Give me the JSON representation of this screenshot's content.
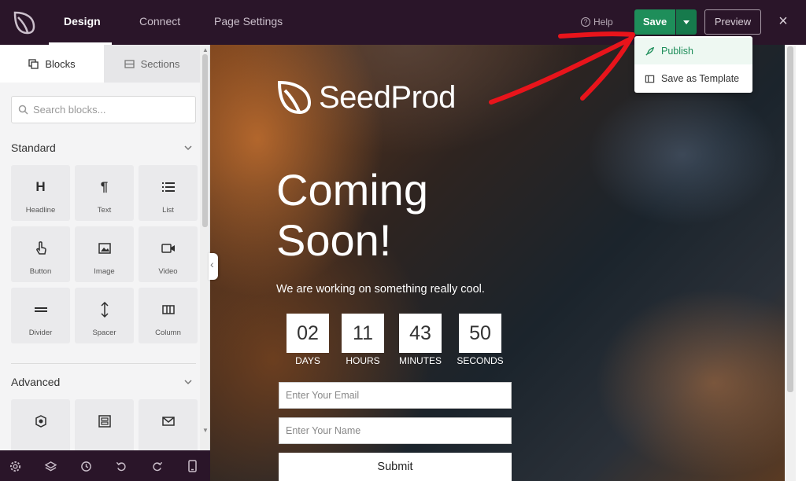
{
  "topbar": {
    "tabs": [
      "Design",
      "Connect",
      "Page Settings"
    ],
    "help_label": "Help",
    "save_label": "Save",
    "preview_label": "Preview",
    "close_symbol": "×"
  },
  "save_menu": {
    "items": [
      {
        "label": "Publish",
        "icon": "rocket-icon"
      },
      {
        "label": "Save as Template",
        "icon": "template-icon"
      }
    ]
  },
  "left_panel": {
    "tabs": [
      "Blocks",
      "Sections"
    ],
    "search_placeholder": "Search blocks...",
    "groups": [
      {
        "title": "Standard",
        "blocks": [
          {
            "label": "Headline",
            "icon": "H"
          },
          {
            "label": "Text",
            "icon": "¶"
          },
          {
            "label": "List",
            "icon": "list-icon"
          },
          {
            "label": "Button",
            "icon": "pointer-icon"
          },
          {
            "label": "Image",
            "icon": "image-icon"
          },
          {
            "label": "Video",
            "icon": "video-icon"
          },
          {
            "label": "Divider",
            "icon": "divider-icon"
          },
          {
            "label": "Spacer",
            "icon": "spacer-icon"
          },
          {
            "label": "Column",
            "icon": "column-icon"
          }
        ]
      },
      {
        "title": "Advanced",
        "blocks": [
          {
            "label": "",
            "icon": "badge-icon"
          },
          {
            "label": "",
            "icon": "form-icon"
          },
          {
            "label": "",
            "icon": "mail-icon"
          }
        ]
      }
    ]
  },
  "bottom_toolbar": [
    "settings-icon",
    "layers-icon",
    "history-icon",
    "undo-icon",
    "redo-icon",
    "mobile-icon"
  ],
  "page": {
    "brand": "SeedProd",
    "headline_line1": "Coming",
    "headline_line2": "Soon!",
    "subtext": "We are working on something really cool.",
    "countdown": [
      {
        "value": "02",
        "label": "DAYS"
      },
      {
        "value": "11",
        "label": "HOURS"
      },
      {
        "value": "43",
        "label": "MINUTES"
      },
      {
        "value": "50",
        "label": "SECONDS"
      }
    ],
    "email_placeholder": "Enter Your Email",
    "name_placeholder": "Enter Your Name",
    "submit_label": "Submit"
  },
  "colors": {
    "topbar": "#2a1529",
    "save_green": "#1e8e5a",
    "annotation_arrow": "#e8141b"
  }
}
